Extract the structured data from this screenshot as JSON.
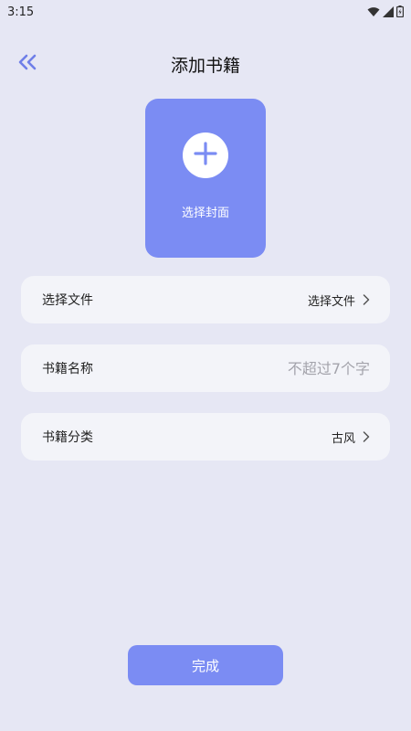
{
  "status_bar": {
    "time": "3:15",
    "icons": [
      "wifi-icon",
      "signal-icon",
      "battery-icon"
    ]
  },
  "header": {
    "title": "添加书籍",
    "back_icon": "double-chevron-left-icon"
  },
  "cover": {
    "label": "选择封面",
    "icon": "plus-icon"
  },
  "rows": [
    {
      "label": "选择文件",
      "value": "选择文件",
      "icon": "chevron-right-icon"
    },
    {
      "label": "书籍名称",
      "value": "",
      "placeholder": "不超过7个字"
    },
    {
      "label": "书籍分类",
      "value": "古风",
      "icon": "chevron-right-icon"
    }
  ],
  "done_button": {
    "label": "完成"
  },
  "colors": {
    "background": "#E6E7F4",
    "accent": "#7B8CF3",
    "row_background": "#F3F4F9",
    "placeholder": "#A3A3AB"
  }
}
